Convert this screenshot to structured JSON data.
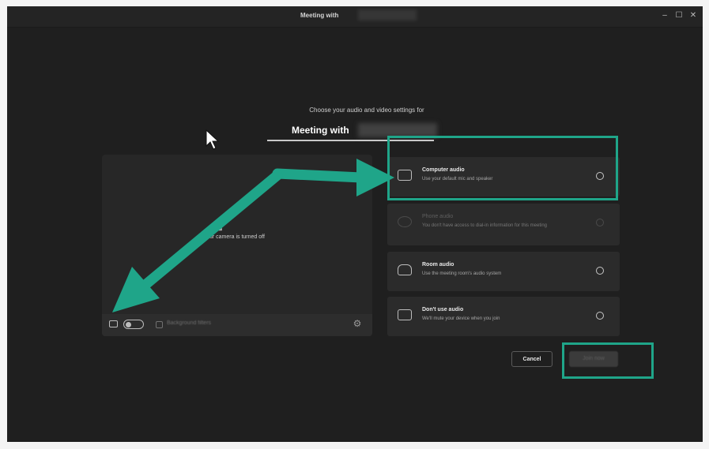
{
  "window": {
    "title": "Meeting with",
    "controls": {
      "minimize": "–",
      "maximize": "☐",
      "close": "✕"
    }
  },
  "prejoin": {
    "prompt": "Choose your audio and video settings for",
    "meeting_title": "Meeting with"
  },
  "preview": {
    "camera_off_icon": "camera-off-icon",
    "camera_off_text": "Your camera is turned off",
    "background_filters_label": "Background filters",
    "camera_toggle": "off"
  },
  "audio_options": [
    {
      "title": "Computer audio",
      "desc": "Use your default mic and speaker",
      "icon": "computer-icon",
      "selected": true,
      "disabled": false
    },
    {
      "title": "Phone audio",
      "desc": "You don't have access to dial-in information for this meeting",
      "icon": "phone-icon",
      "selected": false,
      "disabled": true
    },
    {
      "title": "Room audio",
      "desc": "Use the meeting room's audio system",
      "icon": "room-icon",
      "selected": false,
      "disabled": false
    },
    {
      "title": "Don't use audio",
      "desc": "We'll mute your device when you join",
      "icon": "no-audio-icon",
      "selected": false,
      "disabled": false
    }
  ],
  "buttons": {
    "cancel": "Cancel",
    "join": "Join now"
  },
  "colors": {
    "highlight": "#1fa589",
    "background": "#1f1f1f",
    "panel": "#2b2b2b"
  }
}
